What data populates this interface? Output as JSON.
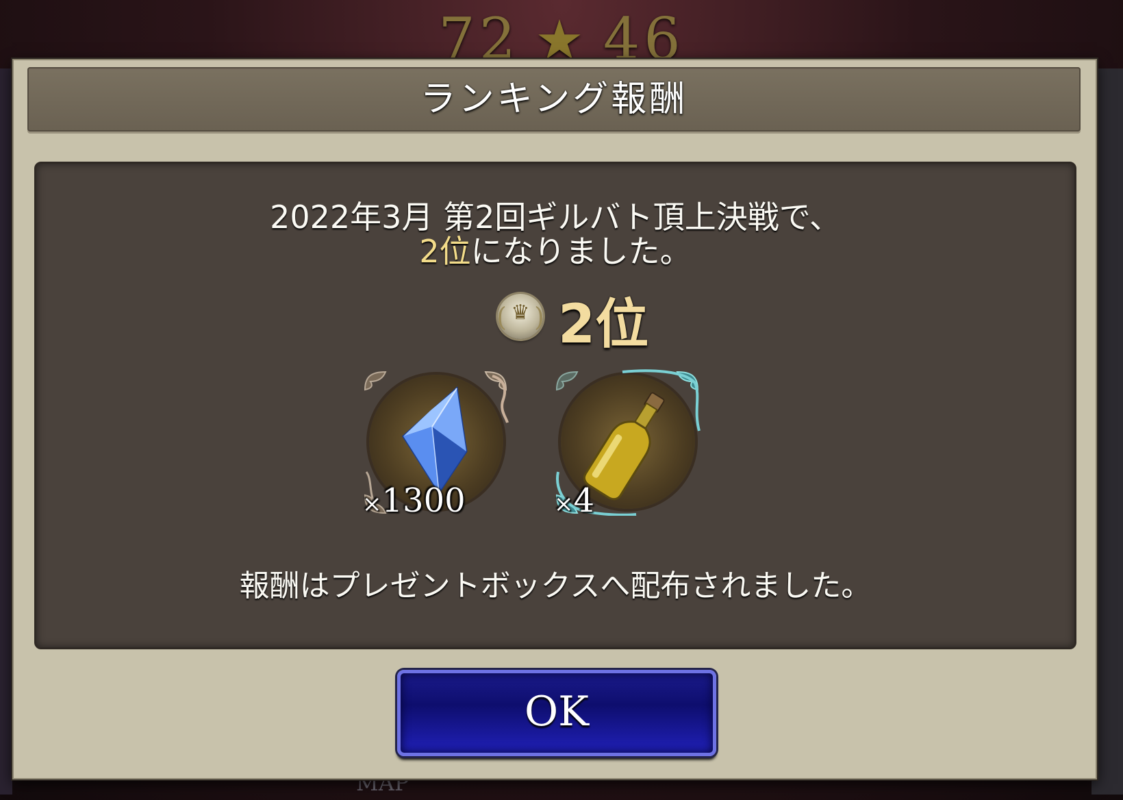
{
  "background": {
    "score_left": "72",
    "score_right": "46",
    "map_label": "MAP"
  },
  "dialog": {
    "title": "ランキング報酬",
    "message_line1": "2022年3月 第2回ギルバト頂上決戦で、",
    "message_line2_highlight": "2位",
    "message_line2_rest": "になりました。",
    "rank_text": "2位",
    "rewards": [
      {
        "icon": "blue-crystal-icon",
        "quantity": "1300",
        "prefix": "×"
      },
      {
        "icon": "golden-bottle-icon",
        "quantity": "4",
        "prefix": "×"
      }
    ],
    "notice": "報酬はプレゼントボックスへ配布されました。",
    "ok_label": "OK"
  },
  "colors": {
    "highlight": "#f3dc8a",
    "button_blue": "#1a1a8a",
    "button_border": "#6e72e4",
    "panel_dark": "#4a423c",
    "frame_beige": "#c8c2ab"
  }
}
